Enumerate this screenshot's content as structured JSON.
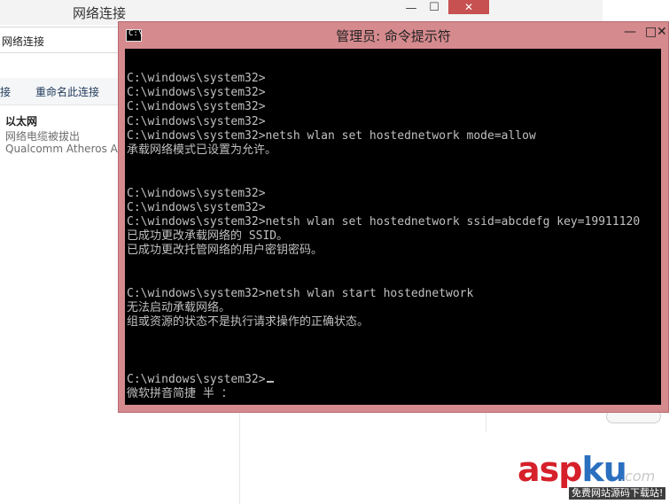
{
  "background_window": {
    "title": "网络连接",
    "min_label": "—",
    "max_label": "☐",
    "close_label": "✕",
    "address": "网络连接",
    "toolbar": [
      "接",
      "重命名此连接"
    ],
    "adapter": {
      "name": "以太网",
      "status": "网络电缆被拔出",
      "device": "Qualcomm Atheros A"
    }
  },
  "cmd_window": {
    "title": "管理员: 命令提示符",
    "icon_label": "C:\\",
    "controls": {
      "minimize": "—",
      "maximize": "□",
      "close": "✕"
    },
    "lines": [
      "C:\\windows\\system32>",
      "C:\\windows\\system32>",
      "C:\\windows\\system32>",
      "C:\\windows\\system32>",
      "C:\\windows\\system32>netsh wlan set hostednetwork mode=allow",
      "承载网络模式已设置为允许。",
      "",
      "",
      "C:\\windows\\system32>",
      "C:\\windows\\system32>",
      "C:\\windows\\system32>netsh wlan set hostednetwork ssid=abcdefg key=19911120",
      "已成功更改承载网络的 SSID。",
      "已成功更改托管网络的用户密钥密码。",
      "",
      "",
      "C:\\windows\\system32>netsh wlan start hostednetwork",
      "无法启动承载网络。",
      "组或资源的状态不是执行请求操作的正确状态。",
      "",
      "",
      "",
      "C:\\windows\\system32>"
    ],
    "ime_status": "微软拼音简捷 半 ："
  },
  "watermark": {
    "asp": "asp",
    "ku": "ku",
    "com": ".com",
    "tagline": "免费网站源码下载站!"
  },
  "colors": {
    "cmd_frame": "#d58a8e",
    "console_bg": "#000000",
    "console_text": "#c0c0c0",
    "watermark_red": "#d6202a",
    "watermark_blue": "#2b6fbf"
  }
}
